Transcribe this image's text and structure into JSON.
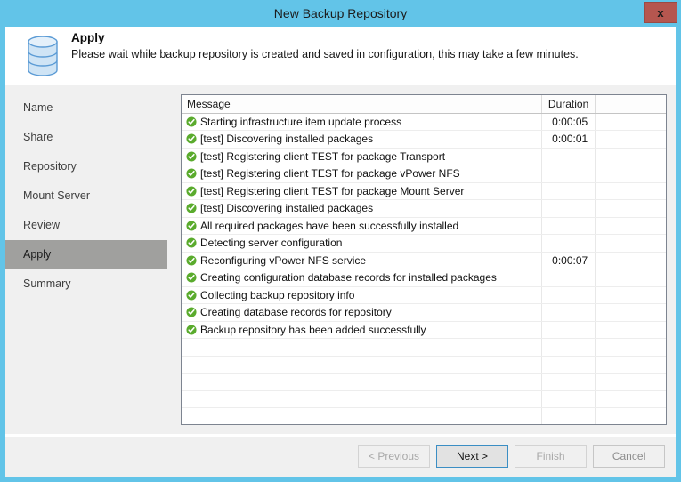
{
  "window": {
    "title": "New Backup Repository",
    "close_label": "x",
    "close_icon": "close-icon"
  },
  "header": {
    "icon": "database-repository-icon",
    "title": "Apply",
    "subtitle": "Please wait while backup repository is created and saved in configuration, this may take a few minutes."
  },
  "sidebar": {
    "items": [
      {
        "label": "Name",
        "selected": false
      },
      {
        "label": "Share",
        "selected": false
      },
      {
        "label": "Repository",
        "selected": false
      },
      {
        "label": "Mount Server",
        "selected": false
      },
      {
        "label": "Review",
        "selected": false
      },
      {
        "label": "Apply",
        "selected": true
      },
      {
        "label": "Summary",
        "selected": false
      }
    ]
  },
  "table": {
    "columns": [
      "Message",
      "Duration",
      ""
    ],
    "row_icon": "success-check-icon",
    "rows": [
      {
        "message": "Starting infrastructure item update process",
        "duration": "0:00:05"
      },
      {
        "message": "[test] Discovering installed packages",
        "duration": "0:00:01"
      },
      {
        "message": "[test] Registering client TEST for package Transport",
        "duration": ""
      },
      {
        "message": "[test] Registering client TEST for package vPower NFS",
        "duration": ""
      },
      {
        "message": "[test] Registering client TEST for package Mount Server",
        "duration": ""
      },
      {
        "message": "[test] Discovering installed packages",
        "duration": ""
      },
      {
        "message": "All required packages have been successfully installed",
        "duration": ""
      },
      {
        "message": "Detecting server configuration",
        "duration": ""
      },
      {
        "message": "Reconfiguring vPower NFS service",
        "duration": "0:00:07"
      },
      {
        "message": "Creating configuration database records for installed packages",
        "duration": ""
      },
      {
        "message": "Collecting backup repository info",
        "duration": ""
      },
      {
        "message": "Creating database records for repository",
        "duration": ""
      },
      {
        "message": "Backup repository has been added successfully",
        "duration": ""
      }
    ],
    "empty_row_count": 5
  },
  "footer": {
    "buttons": [
      {
        "label": "< Previous",
        "state": "disabled"
      },
      {
        "label": "Next >",
        "state": "default"
      },
      {
        "label": "Finish",
        "state": "disabled"
      },
      {
        "label": "Cancel",
        "state": "enabled"
      }
    ]
  },
  "colors": {
    "title_bar": "#62c4e8",
    "close_button": "#b5564f",
    "sidebar_bg": "#f0f0f0",
    "selected_nav": "#a0a09e",
    "success_green": "#5aab2d",
    "default_button_border": "#3b8ec4"
  }
}
